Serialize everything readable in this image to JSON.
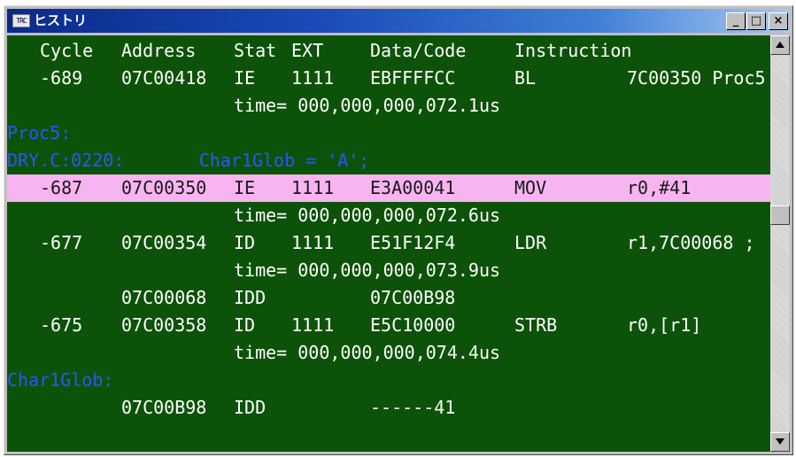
{
  "window": {
    "title": "ヒストリ",
    "icon_text": "TRC",
    "controls": {
      "minimize": "_",
      "maximize": "□",
      "close": "×"
    }
  },
  "trace": {
    "header": [
      "Cycle",
      "Address",
      "Stat",
      "EXT",
      "Data/Code",
      "Instruction"
    ],
    "rows": [
      {
        "kind": "entry",
        "cycle": "-689",
        "address": "07C00418",
        "stat": "IE",
        "ext": "1111",
        "data": "EBFFFFCC",
        "mnemonic": "BL",
        "operands": "7C00350 Proc5"
      },
      {
        "kind": "time",
        "text": "time= 000,000,000,072.1us"
      },
      {
        "kind": "label",
        "text": "Proc5:"
      },
      {
        "kind": "label",
        "text": "DRY.C:0220:       Char1Glob = 'A';"
      },
      {
        "kind": "entry",
        "selected": true,
        "cycle": "-687",
        "address": "07C00350",
        "stat": "IE",
        "ext": "1111",
        "data": "E3A00041",
        "mnemonic": "MOV",
        "operands": "r0,#41"
      },
      {
        "kind": "time",
        "text": "time= 000,000,000,072.6us"
      },
      {
        "kind": "entry",
        "cycle": "-677",
        "address": "07C00354",
        "stat": "ID",
        "ext": "1111",
        "data": "E51F12F4",
        "mnemonic": "LDR",
        "operands": "r1,7C00068 ;"
      },
      {
        "kind": "time",
        "text": "time= 000,000,000,073.9us"
      },
      {
        "kind": "entry",
        "cycle": "",
        "address": "07C00068",
        "stat": "IDD",
        "ext": "",
        "data": "07C00B98",
        "mnemonic": "",
        "operands": ""
      },
      {
        "kind": "entry",
        "cycle": "-675",
        "address": "07C00358",
        "stat": "ID",
        "ext": "1111",
        "data": "E5C10000",
        "mnemonic": "STRB",
        "operands": "r0,[r1]"
      },
      {
        "kind": "time",
        "text": "time= 000,000,000,074.4us"
      },
      {
        "kind": "label",
        "text": "Char1Glob:"
      },
      {
        "kind": "entry",
        "cycle": "",
        "address": "07C00B98",
        "stat": "IDD",
        "ext": "",
        "data": "------41",
        "mnemonic": "",
        "operands": ""
      }
    ]
  },
  "scrollbar": {
    "position_fraction": 0.42
  },
  "colors": {
    "background": "#0d5209",
    "text": "#ffffff",
    "label": "#2f52ff",
    "selected_row": "#f8b4f0"
  }
}
